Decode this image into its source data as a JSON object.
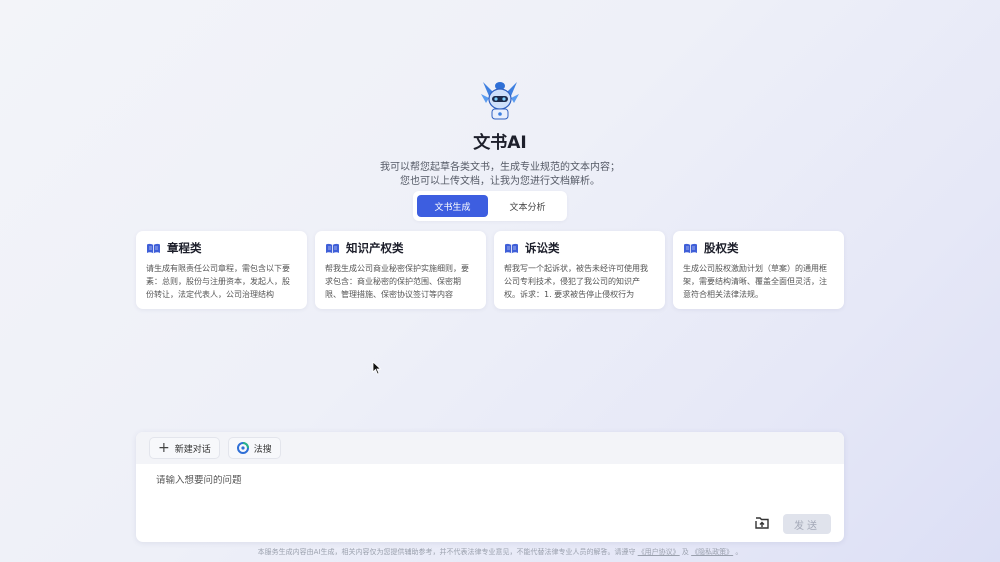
{
  "app": {
    "title": "文书AI",
    "subtitle_line1": "我可以帮您起草各类文书，生成专业规范的文本内容；",
    "subtitle_line2": "您也可以上传文档，让我为您进行文档解析。",
    "mascot_icon": "robot-mascot-icon"
  },
  "tabs": [
    {
      "label": "文书生成",
      "active": true
    },
    {
      "label": "文本分析",
      "active": false
    }
  ],
  "cards": [
    {
      "title": "章程类",
      "desc": "请生成有限责任公司章程，需包含以下要素：总则，股份与注册资本，发起人，股份转让，法定代表人，公司治理结构"
    },
    {
      "title": "知识产权类",
      "desc": "帮我生成公司商业秘密保护实施细则，要求包含：商业秘密的保护范围、保密期限、管理措施、保密协议签订等内容"
    },
    {
      "title": "诉讼类",
      "desc": "帮我写一个起诉状，被告未经许可使用我公司专利技术，侵犯了我公司的知识产权。诉求：1. 要求被告停止侵权行为"
    },
    {
      "title": "股权类",
      "desc": "生成公司股权激励计划（草案）的通用框架，需要结构清晰、覆盖全面但灵活，注意符合相关法律法规。"
    }
  ],
  "composer": {
    "new_chat_label": "新建对话",
    "fasou_label": "法搜",
    "placeholder": "请输入想要问的问题",
    "send_label": "发送",
    "upload_icon": "upload-icon"
  },
  "footer": {
    "text": "本服务生成内容由AI生成，相关内容仅为您提供辅助参考，并不代表法律专业意见，不能代替法律专业人员的解答。请遵守",
    "user_agreement": "《用户协议》",
    "and": "及",
    "privacy_policy": "《隐私政策》",
    "end": "。"
  },
  "colors": {
    "accent": "#3d5ee0",
    "card_icon": "#3f5fd8"
  }
}
